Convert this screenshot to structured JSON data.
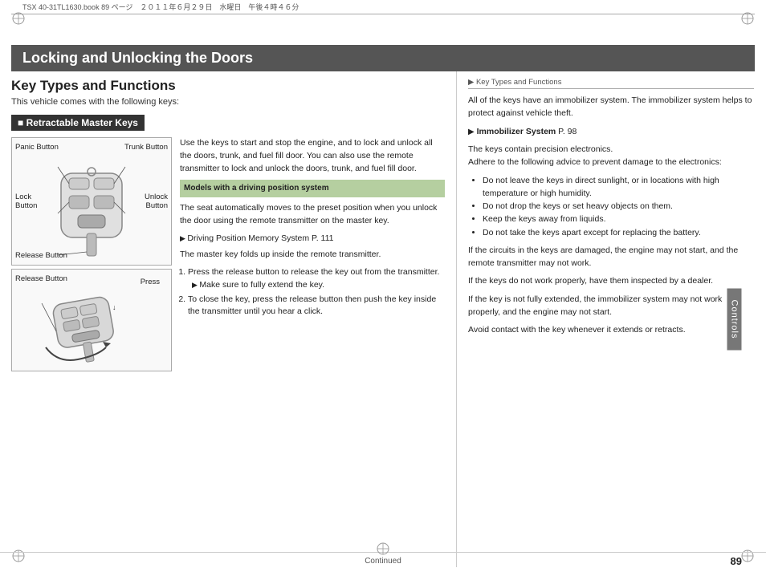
{
  "meta": {
    "file": "TSX 40-31TL1630.book  89 ページ　２０１１年６月２９日　水曜日　午後４時４６分"
  },
  "header": {
    "title": "Locking and Unlocking the Doors"
  },
  "page_title": "Key Types and Functions",
  "page_subtitle": "This vehicle comes with the following keys:",
  "section_heading": "■ Retractable Master Keys",
  "key_diagram": {
    "labels": {
      "panic_button": "Panic Button",
      "trunk_button": "Trunk Button",
      "lock_button": "Lock\nButton",
      "unlock_button": "Unlock\nButton",
      "release_button": "Release Button",
      "press": "Press"
    }
  },
  "main_text": {
    "paragraph1": "Use the keys to start and stop the engine, and to lock and unlock all the doors, trunk, and fuel fill door. You can also use the remote transmitter to lock and unlock the doors, trunk, and fuel fill door.",
    "driving_model_label": "Models with a driving position system",
    "driving_model_text": "The seat automatically moves to the preset position when you unlock the door using the remote transmitter on the master key.",
    "driving_ref": "Driving Position Memory System P. 111",
    "fold_text": "The master key folds up inside the remote transmitter.",
    "steps": [
      {
        "num": "1.",
        "text": "Press the release button to release the key out from the transmitter.",
        "sub": "Make sure to fully extend the key."
      },
      {
        "num": "2.",
        "text": "To close the key, press the release button then push the key inside the transmitter until you hear a click."
      }
    ]
  },
  "right_col": {
    "breadcrumb": "▶ Key Types and Functions",
    "immobilizer_intro": "All of the keys have an immobilizer system. The immobilizer system helps to protect against vehicle theft.",
    "immobilizer_ref": "Immobilizer System P. 98",
    "precision_text": "The keys contain precision electronics.\nAdhere to the following advice to prevent damage to the electronics:",
    "bullets": [
      "Do not leave the keys in direct sunlight, or in locations with high temperature or high humidity.",
      "Do not drop the keys or set heavy objects on them.",
      "Keep the keys away from liquids.",
      "Do not take the keys apart except for replacing the battery."
    ],
    "damaged_text": "If the circuits in the keys are damaged, the engine may not start, and the remote transmitter may not work.",
    "not_work_text": "If the keys do not work properly, have them inspected by a dealer.",
    "not_extended_text": "If the key is not fully extended, the immobilizer system may not work properly, and the engine may not start.",
    "avoid_text": "Avoid contact with the key whenever it extends or retracts."
  },
  "footer": {
    "continued": "Continued",
    "page_number": "89"
  },
  "controls_tab": "Controls"
}
